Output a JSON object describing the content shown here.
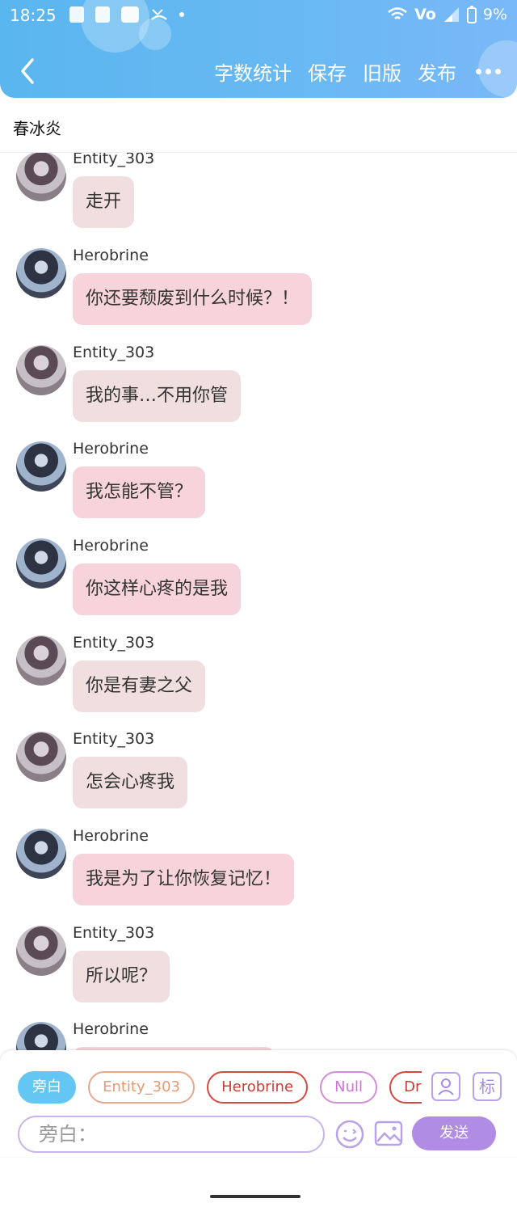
{
  "status_bar": {
    "time": "18:25",
    "network": "Vo",
    "battery": "9%"
  },
  "header": {
    "back_icon": "chevron-left-icon",
    "actions": [
      "字数统计",
      "保存",
      "旧版",
      "发布"
    ],
    "more_icon": "more-dots-icon"
  },
  "title": "春冰炎",
  "messages": [
    {
      "sender": "Entity_303",
      "text": "走开",
      "role": "entity"
    },
    {
      "sender": "Herobrine",
      "text": "你还要颓废到什么时候？！",
      "role": "hero"
    },
    {
      "sender": "Entity_303",
      "text": "我的事…不用你管",
      "role": "entity"
    },
    {
      "sender": "Herobrine",
      "text": "我怎能不管？",
      "role": "hero"
    },
    {
      "sender": "Herobrine",
      "text": "你这样心疼的是我",
      "role": "hero"
    },
    {
      "sender": "Entity_303",
      "text": "你是有妻之父",
      "role": "entity"
    },
    {
      "sender": "Entity_303",
      "text": "怎会心疼我",
      "role": "entity"
    },
    {
      "sender": "Herobrine",
      "text": "我是为了让你恢复记忆！",
      "role": "hero"
    },
    {
      "sender": "Entity_303",
      "text": "所以呢？",
      "role": "entity"
    },
    {
      "sender": "Herobrine",
      "text": "",
      "role": "hero"
    }
  ],
  "composer": {
    "roles": [
      "旁白",
      "Entity_303",
      "Herobrine",
      "Null",
      "Drea"
    ],
    "input_placeholder": "旁白：",
    "send_label": "发送",
    "tool_icons": [
      "character-icon",
      "tag-icon",
      "emoji-icon",
      "image-icon"
    ],
    "tag_label": "标"
  },
  "colors": {
    "header": "#5ab6ef",
    "bubble_entity": "#f1dfe0",
    "bubble_hero": "#f7d3dc",
    "send": "#b08ce4"
  }
}
